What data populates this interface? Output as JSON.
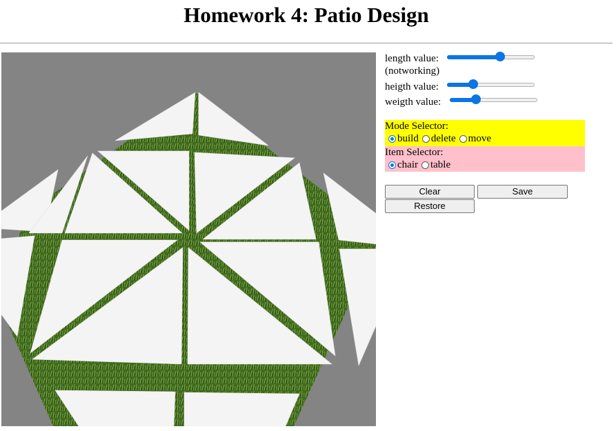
{
  "page": {
    "title": "Homework 4: Patio Design"
  },
  "colors": {
    "mode_panel_bg": "#ffff00",
    "item_panel_bg": "#ffc0cb",
    "canvas_bg": "#848484",
    "grass": "#3f6a1e",
    "marble": "#f4f4f4",
    "accent": "#0a75e5"
  },
  "sliders": {
    "length": {
      "label": "length value:",
      "note": "(notworking)",
      "value_fraction": 0.62
    },
    "heigth": {
      "label": "heigth value:",
      "value_fraction": 0.27
    },
    "weigth": {
      "label": "weigth value:",
      "value_fraction": 0.27
    }
  },
  "mode_selector": {
    "label": "Mode Selector:",
    "options": [
      "build",
      "delete",
      "move"
    ],
    "selected": "build"
  },
  "item_selector": {
    "label": "Item Selector:",
    "options": [
      "chair",
      "table"
    ],
    "selected": "chair"
  },
  "buttons": {
    "clear": "Clear",
    "save": "Save",
    "restore": "Restore"
  }
}
